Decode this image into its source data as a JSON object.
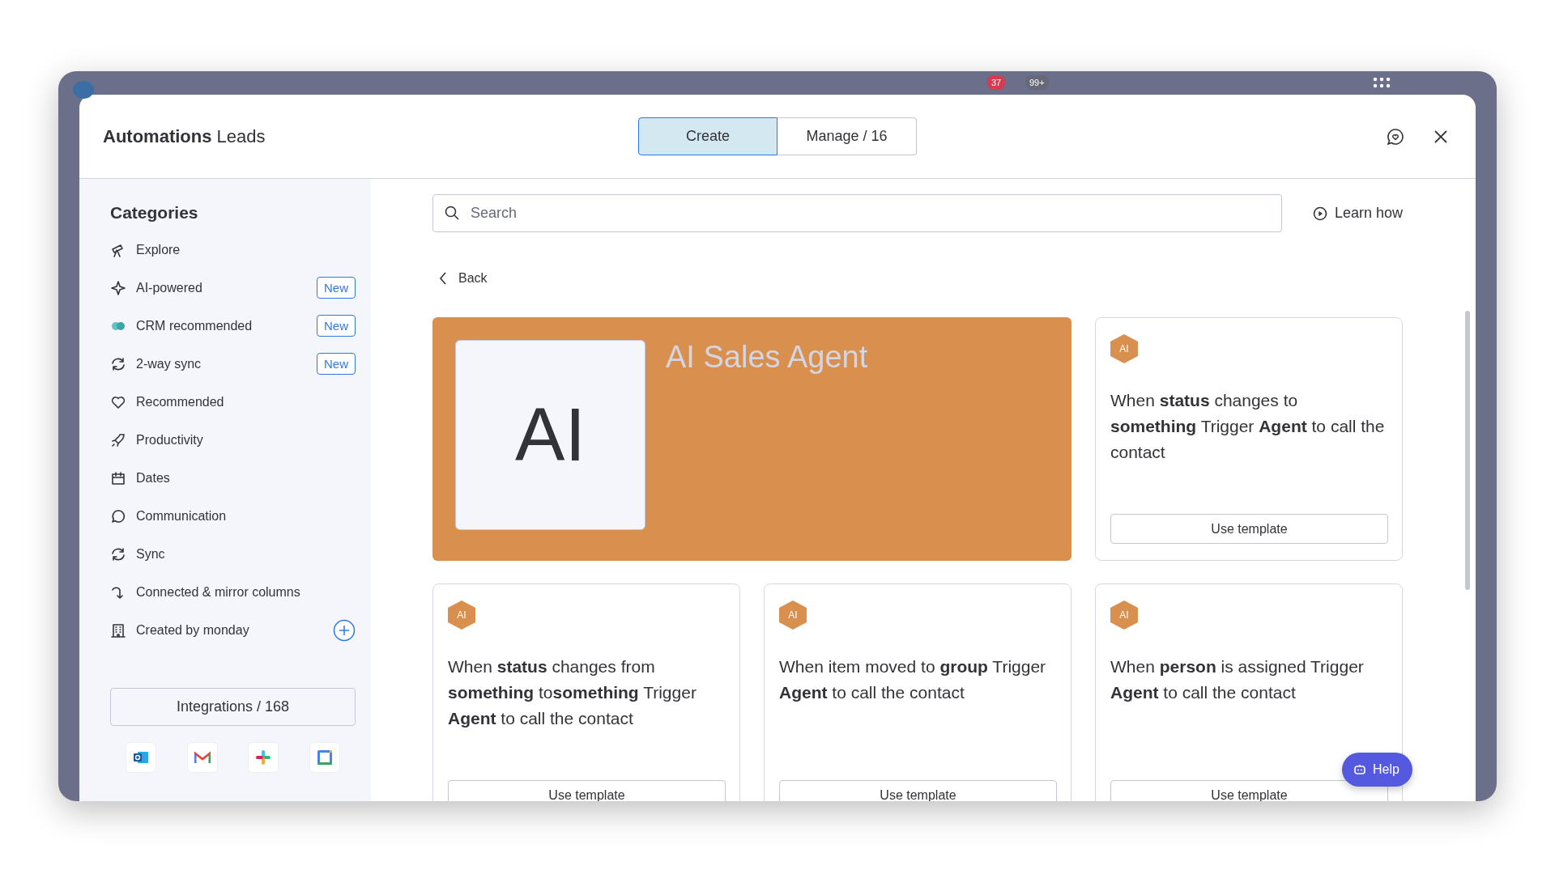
{
  "app_bar": {
    "badges": [
      {
        "text": "37",
        "color": "#d83a52"
      },
      {
        "text": "99+",
        "color": "#676879"
      }
    ]
  },
  "modal": {
    "title": "**Automations** Leads"
  },
  "tabs": [
    {
      "label": "Create",
      "selected": true
    },
    {
      "label": "Manage / 16",
      "selected": false
    }
  ],
  "sidebar": {
    "heading": "Categories",
    "items": [
      {
        "label": "Explore"
      },
      {
        "label": "AI-powered",
        "badge": "New"
      },
      {
        "label": "CRM recommended",
        "badge": "New"
      },
      {
        "label": "2-way sync",
        "badge": "New"
      },
      {
        "label": "Recommended"
      },
      {
        "label": "Productivity"
      },
      {
        "label": "Dates"
      },
      {
        "label": "Communication"
      },
      {
        "label": "Sync"
      },
      {
        "label": "Connected & mirror columns"
      },
      {
        "label": "Created by monday"
      }
    ],
    "integrations_button": "Integrations / 168"
  },
  "search": {
    "placeholder": "Search"
  },
  "learn_how": "Learn how",
  "back": "Back",
  "hero": {
    "tile": "AI",
    "title": "AI Sales Agent"
  },
  "templates": [
    {
      "badge": "AI",
      "text": "When **status** changes to **something** Trigger **Agent** to call the contact",
      "button": "Use template"
    },
    {
      "badge": "AI",
      "text": "When **status** changes from **something** to**something** Trigger **Agent** to call the contact",
      "button": "Use template"
    },
    {
      "badge": "AI",
      "text": "When item moved to **group** Trigger **Agent** to call the contact",
      "button": "Use template"
    },
    {
      "badge": "AI",
      "text": "When **person** is assigned Trigger **Agent** to call the contact",
      "button": "Use template"
    }
  ],
  "help": "Help"
}
